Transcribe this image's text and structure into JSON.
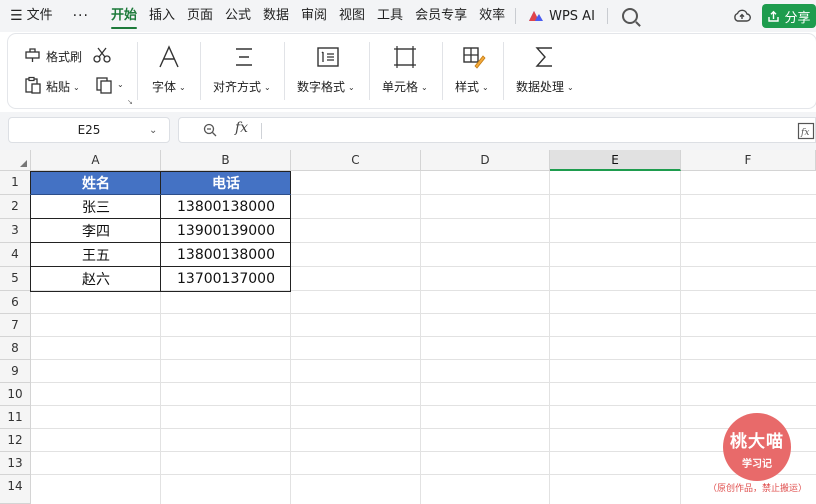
{
  "menu": {
    "icon": "hamburger-menu-icon",
    "file": "文件",
    "more": "···",
    "tabs": [
      "开始",
      "插入",
      "页面",
      "公式",
      "数据",
      "审阅",
      "视图",
      "工具",
      "会员专享",
      "效率"
    ],
    "active_tab": "开始",
    "wps_ai": "WPS AI",
    "share": "分享"
  },
  "ribbon": {
    "format_painter": "格式刷",
    "paste": "粘贴",
    "font": "字体",
    "align": "对齐方式",
    "number_format": "数字格式",
    "cell": "单元格",
    "style": "样式",
    "data_process": "数据处理"
  },
  "formula_bar": {
    "name_box": "E25",
    "fx": "fx",
    "value": ""
  },
  "grid": {
    "columns": [
      "A",
      "B",
      "C",
      "D",
      "E",
      "F"
    ],
    "selected_column": "E",
    "rows": [
      "1",
      "2",
      "3",
      "4",
      "5",
      "6",
      "7",
      "8",
      "9",
      "10",
      "11",
      "12",
      "13",
      "14"
    ],
    "table": {
      "headers": [
        "姓名",
        "电话"
      ],
      "rows": [
        [
          "张三",
          "13800138000"
        ],
        [
          "李四",
          "13900139000"
        ],
        [
          "王五",
          "13800138000"
        ],
        [
          "赵六",
          "13700137000"
        ]
      ]
    }
  },
  "watermark": {
    "title": "桃大喵",
    "subtitle": "学习记",
    "note": "（原创作品，禁止搬运）"
  },
  "colors": {
    "accent": "#1e9c4e",
    "header_fill": "#4472c4",
    "watermark": "#e86a6a"
  }
}
